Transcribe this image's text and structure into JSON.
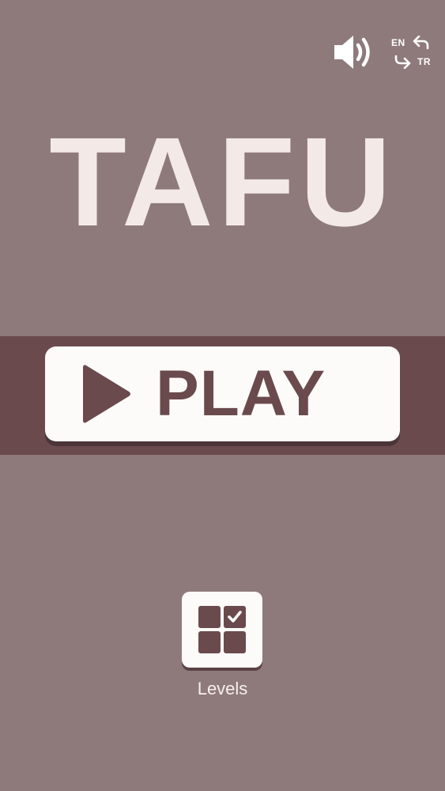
{
  "header": {
    "sound_icon": "speaker-volume-icon",
    "language": {
      "current": "EN",
      "alternate": "TR",
      "icon": "swap-arrows-icon"
    }
  },
  "title": "TAFU",
  "play_button": {
    "label": "PLAY",
    "icon": "play-triangle-icon"
  },
  "levels_button": {
    "label": "Levels",
    "icon": "level-grid-check-icon"
  },
  "colors": {
    "background": "#8e7a7b",
    "band": "#6a4a4d",
    "button": "#fdfbfa",
    "title": "#f3eae7",
    "accent": "#6a4a4d"
  }
}
